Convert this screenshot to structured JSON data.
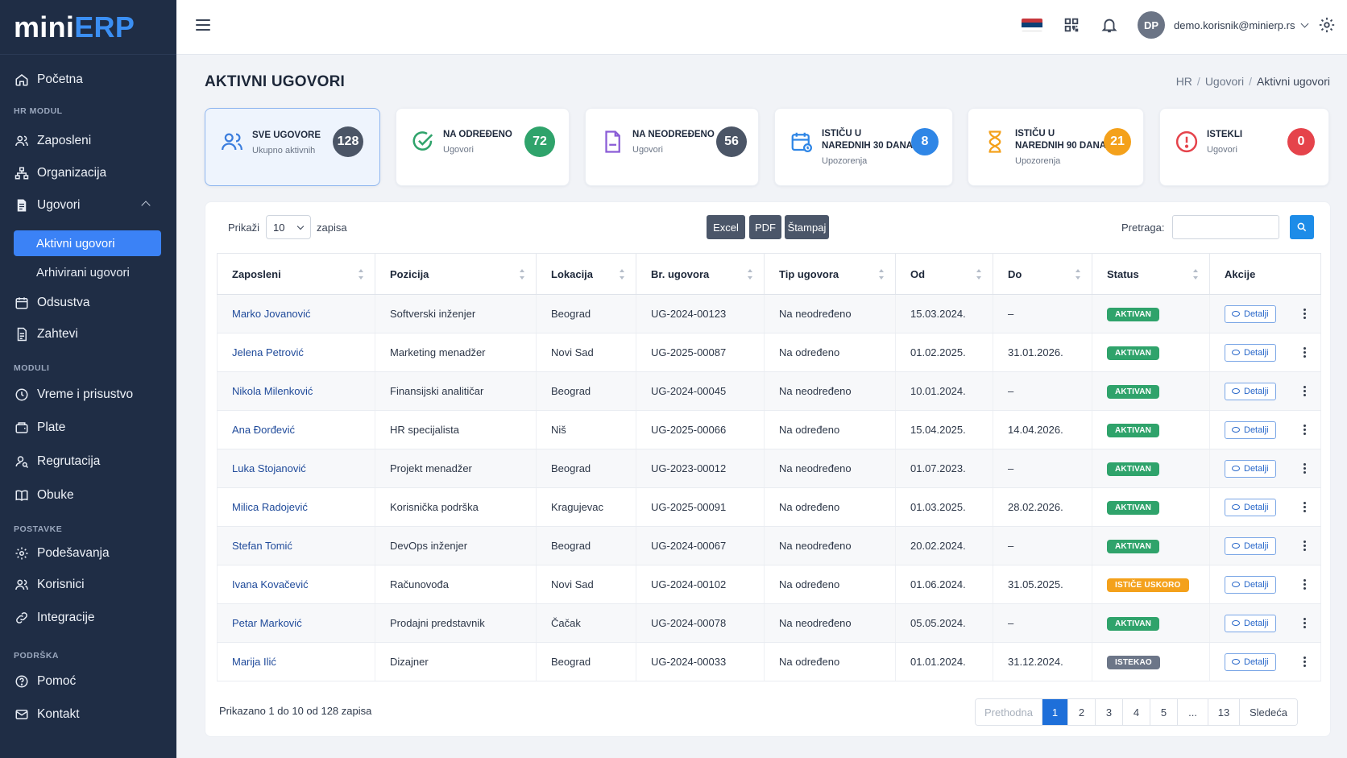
{
  "logo": {
    "part1": "mini",
    "part2": "ERP"
  },
  "sidebar": {
    "home": "Početna",
    "section_hr": "HR MODUL",
    "zaposleni": "Zaposleni",
    "organizacija": "Organizacija",
    "ugovori": "Ugovori",
    "aktivni": "Aktivni ugovori",
    "arhivirani": "Arhivirani ugovori",
    "odsustva": "Odsustva",
    "zahtevi": "Zahtevi",
    "section_moduli": "MODULI",
    "vreme": "Vreme i prisustvo",
    "plate": "Plate",
    "regrutacija": "Regrutacija",
    "obuke": "Obuke",
    "section_postavke": "POSTAVKE",
    "podesavanja": "Podešavanja",
    "korisnici": "Korisnici",
    "integracije": "Integracije",
    "section_podrska": "PODRŠKA",
    "pomoc": "Pomoć",
    "kontakt": "Kontakt"
  },
  "topbar": {
    "avatar_initials": "DP",
    "user_email": "demo.korisnik@minierp.rs"
  },
  "page": {
    "title": "AKTIVNI UGOVORI",
    "breadcrumb": [
      "HR",
      "Ugovori",
      "Aktivni ugovori"
    ]
  },
  "cards": [
    {
      "title": "SVE UGOVORE",
      "subtitle": "Ukupno aktivnih",
      "value": "128",
      "color": "#4b5566",
      "icon": "users-icon"
    },
    {
      "title": "NA ODREĐENO",
      "subtitle": "Ugovori",
      "value": "72",
      "color": "#2fa36b",
      "icon": "check-circle-icon"
    },
    {
      "title": "NA NEODREĐENO",
      "subtitle": "Ugovori",
      "value": "56",
      "color": "#4b5566",
      "icon": "document-icon"
    },
    {
      "title_line1": "ISTIČU U",
      "title_line2": "NAREDNIH 30 DANA",
      "subtitle": "Upozorenja",
      "value": "8",
      "color": "#2f86e6",
      "icon": "calendar-icon"
    },
    {
      "title_line1": "ISTIČU U",
      "title_line2": "NAREDNIH 90 DANA",
      "subtitle": "Upozorenja",
      "value": "21",
      "color": "#f4a11b",
      "icon": "hourglass-icon"
    },
    {
      "title": "ISTEKLI",
      "subtitle": "Ugovori",
      "value": "0",
      "color": "#e5434b",
      "icon": "alert-icon"
    }
  ],
  "toolbar": {
    "show_label": "Prikaži",
    "page_size": "10",
    "records_label": "zapisa",
    "excel": "Excel",
    "pdf": "PDF",
    "print": "Štampaj",
    "search_label": "Pretraga:",
    "search_value": ""
  },
  "table": {
    "columns": [
      "Zaposleni",
      "Pozicija",
      "Lokacija",
      "Br. ugovora",
      "Tip ugovora",
      "Od",
      "Do",
      "Status",
      "Akcije"
    ],
    "details_label": "Detalji",
    "rows": [
      {
        "employee": "Marko Jovanović",
        "position": "Softverski inženjer",
        "location": "Beograd",
        "contract": "UG-2024-00123",
        "type": "Na neodređeno",
        "from": "15.03.2024.",
        "to": "–",
        "status": "AKTIVAN",
        "status_kind": "green"
      },
      {
        "employee": "Jelena Petrović",
        "position": "Marketing menadžer",
        "location": "Novi Sad",
        "contract": "UG-2025-00087",
        "type": "Na određeno",
        "from": "01.02.2025.",
        "to": "31.01.2026.",
        "status": "AKTIVAN",
        "status_kind": "green"
      },
      {
        "employee": "Nikola Milenković",
        "position": "Finansijski analitičar",
        "location": "Beograd",
        "contract": "UG-2024-00045",
        "type": "Na neodređeno",
        "from": "10.01.2024.",
        "to": "–",
        "status": "AKTIVAN",
        "status_kind": "green"
      },
      {
        "employee": "Ana Đorđević",
        "position": "HR specijalista",
        "location": "Niš",
        "contract": "UG-2025-00066",
        "type": "Na određeno",
        "from": "15.04.2025.",
        "to": "14.04.2026.",
        "status": "AKTIVAN",
        "status_kind": "green"
      },
      {
        "employee": "Luka Stojanović",
        "position": "Projekt menadžer",
        "location": "Beograd",
        "contract": "UG-2023-00012",
        "type": "Na neodređeno",
        "from": "01.07.2023.",
        "to": "–",
        "status": "AKTIVAN",
        "status_kind": "green"
      },
      {
        "employee": "Milica Radojević",
        "position": "Korisnička podrška",
        "location": "Kragujevac",
        "contract": "UG-2025-00091",
        "type": "Na određeno",
        "from": "01.03.2025.",
        "to": "28.02.2026.",
        "status": "AKTIVAN",
        "status_kind": "green"
      },
      {
        "employee": "Stefan Tomić",
        "position": "DevOps inženjer",
        "location": "Beograd",
        "contract": "UG-2024-00067",
        "type": "Na neodređeno",
        "from": "20.02.2024.",
        "to": "–",
        "status": "AKTIVAN",
        "status_kind": "green"
      },
      {
        "employee": "Ivana Kovačević",
        "position": "Računovođa",
        "location": "Novi Sad",
        "contract": "UG-2024-00102",
        "type": "Na određeno",
        "from": "01.06.2024.",
        "to": "31.05.2025.",
        "status": "ISTIČE USKORO",
        "status_kind": "orange"
      },
      {
        "employee": "Petar Marković",
        "position": "Prodajni predstavnik",
        "location": "Čačak",
        "contract": "UG-2024-00078",
        "type": "Na neodređeno",
        "from": "05.05.2024.",
        "to": "–",
        "status": "AKTIVAN",
        "status_kind": "green"
      },
      {
        "employee": "Marija Ilić",
        "position": "Dizajner",
        "location": "Beograd",
        "contract": "UG-2024-00033",
        "type": "Na određeno",
        "from": "01.01.2024.",
        "to": "31.12.2024.",
        "status": "ISTEKAO",
        "status_kind": "grey"
      }
    ]
  },
  "footer": {
    "info": "Prikazano 1 do 10 od 128 zapisa",
    "prev": "Prethodna",
    "pages": [
      "1",
      "2",
      "3",
      "4",
      "5",
      "...",
      "13"
    ],
    "current_page": "1",
    "next": "Sledeća"
  },
  "colors": {
    "sidebar": "#1f2d45",
    "accent": "#3b82f6",
    "export_button": "#4b5669",
    "search_button": "#1d8ce8"
  }
}
